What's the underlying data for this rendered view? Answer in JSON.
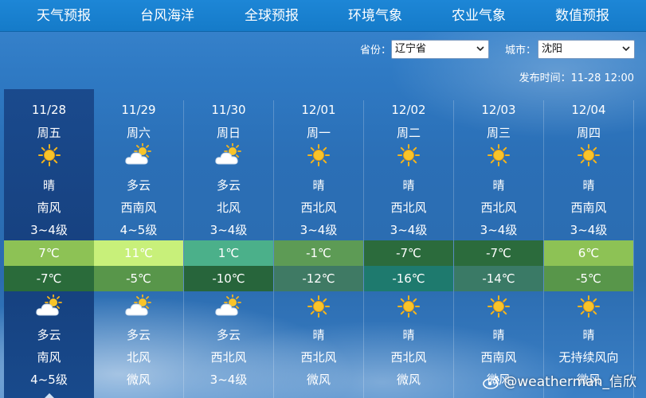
{
  "nav": [
    "天气预报",
    "台风海洋",
    "全球预报",
    "环境气象",
    "农业气象",
    "数值预报"
  ],
  "province": {
    "label": "省份：",
    "value": "辽宁省"
  },
  "city": {
    "label": "城市：",
    "value": "沈阳"
  },
  "publish": "发布时间：11-28 12:00",
  "days": [
    {
      "date": "11/28",
      "weekday": "周五",
      "day_icon": "sunny-icon",
      "day_weather": "晴",
      "day_wind_dir": "南风",
      "day_wind": "3~4级",
      "high": "7℃",
      "high_color": "#8dc255",
      "low": "-7℃",
      "low_color": "#2a6b3a",
      "night_icon": "partly-cloudy-icon",
      "night_weather": "多云",
      "night_wind_dir": "南风",
      "night_wind": "4~5级"
    },
    {
      "date": "11/29",
      "weekday": "周六",
      "day_icon": "partly-cloudy-icon",
      "day_weather": "多云",
      "day_wind_dir": "西南风",
      "day_wind": "4~5级",
      "high": "11℃",
      "high_color": "#c8f07a",
      "low": "-5℃",
      "low_color": "#58964a",
      "night_icon": "partly-cloudy-icon",
      "night_weather": "多云",
      "night_wind_dir": "北风",
      "night_wind": "微风"
    },
    {
      "date": "11/30",
      "weekday": "周日",
      "day_icon": "partly-cloudy-icon",
      "day_weather": "多云",
      "day_wind_dir": "北风",
      "day_wind": "3~4级",
      "high": "1℃",
      "high_color": "#4bb08a",
      "low": "-10℃",
      "low_color": "#27653b",
      "night_icon": "partly-cloudy-icon",
      "night_weather": "多云",
      "night_wind_dir": "西北风",
      "night_wind": "3~4级"
    },
    {
      "date": "12/01",
      "weekday": "周一",
      "day_icon": "sunny-icon",
      "day_weather": "晴",
      "day_wind_dir": "西北风",
      "day_wind": "3~4级",
      "high": "-1℃",
      "high_color": "#5d9b55",
      "low": "-12℃",
      "low_color": "#3f7a64",
      "night_icon": "sunny-icon",
      "night_weather": "晴",
      "night_wind_dir": "西北风",
      "night_wind": "微风"
    },
    {
      "date": "12/02",
      "weekday": "周二",
      "day_icon": "sunny-icon",
      "day_weather": "晴",
      "day_wind_dir": "西北风",
      "day_wind": "3~4级",
      "high": "-7℃",
      "high_color": "#2b6b3c",
      "low": "-16℃",
      "low_color": "#1e7a6e",
      "night_icon": "sunny-icon",
      "night_weather": "晴",
      "night_wind_dir": "西北风",
      "night_wind": "微风"
    },
    {
      "date": "12/03",
      "weekday": "周三",
      "day_icon": "sunny-icon",
      "day_weather": "晴",
      "day_wind_dir": "西北风",
      "day_wind": "3~4级",
      "high": "-7℃",
      "high_color": "#2b6b3c",
      "low": "-14℃",
      "low_color": "#3a7a66",
      "night_icon": "sunny-icon",
      "night_weather": "晴",
      "night_wind_dir": "西南风",
      "night_wind": "微风"
    },
    {
      "date": "12/04",
      "weekday": "周四",
      "day_icon": "sunny-icon",
      "day_weather": "晴",
      "day_wind_dir": "西南风",
      "day_wind": "3~4级",
      "high": "6℃",
      "high_color": "#8dc255",
      "low": "-5℃",
      "low_color": "#58964a",
      "night_icon": "sunny-icon",
      "night_weather": "晴",
      "night_wind_dir": "无持续风向",
      "night_wind": "微风"
    }
  ],
  "watermark": "@weatherman_信欣"
}
